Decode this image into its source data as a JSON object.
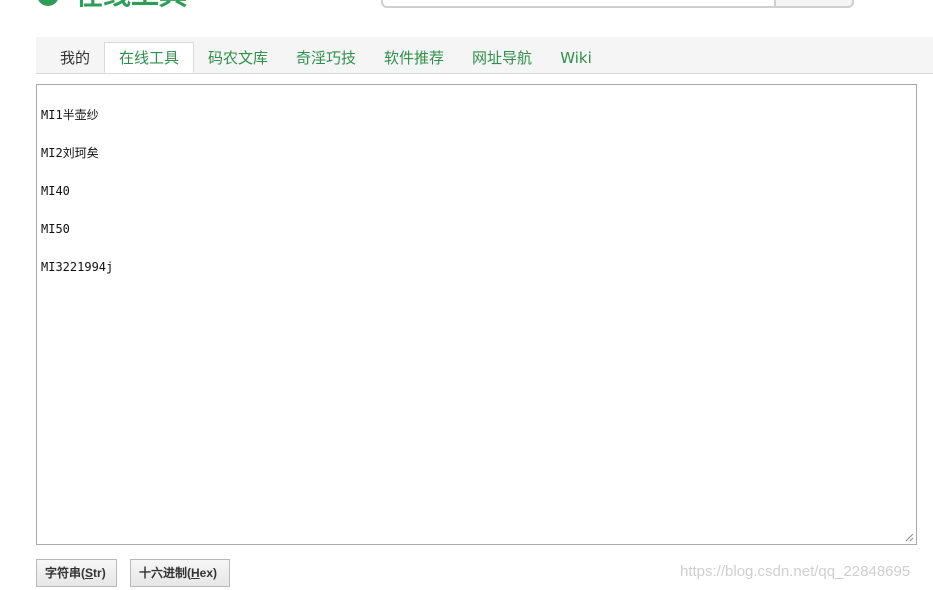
{
  "header": {
    "logo_text": "在线工具"
  },
  "tabs": [
    {
      "label": "我的"
    },
    {
      "label": "在线工具"
    },
    {
      "label": "码农文库"
    },
    {
      "label": "奇淫巧技"
    },
    {
      "label": "软件推荐"
    },
    {
      "label": "网址导航"
    },
    {
      "label": "Wiki"
    }
  ],
  "active_tab": "在线工具",
  "editor": {
    "lines": [
      "MI1半壶纱",
      "MI2刘珂矣",
      "MI40",
      "MI50",
      "MI3221994j"
    ]
  },
  "buttons": {
    "str": {
      "prefix": "字符串(",
      "key": "S",
      "rest": "tr",
      "suffix": ")"
    },
    "hex": {
      "prefix": "十六进制(",
      "key": "H",
      "rest": "ex",
      "suffix": ")"
    }
  },
  "watermark": "https://blog.csdn.net/qq_22848695",
  "colors": {
    "accent_green": "#2e9e57",
    "tab_green": "#2e8f4c",
    "tab_bar_bg": "#f5f5f5",
    "border": "#a9a9a9"
  }
}
